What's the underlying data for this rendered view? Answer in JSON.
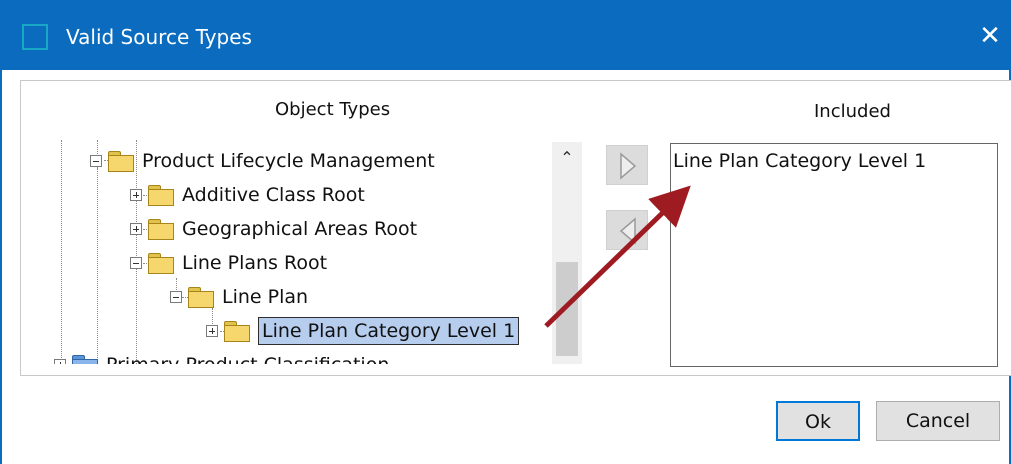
{
  "window": {
    "title": "Valid Source Types",
    "close_glyph": "✕"
  },
  "left_panel": {
    "header": "Object Types"
  },
  "right_panel": {
    "header": "Included"
  },
  "tree": {
    "nodes": [
      {
        "label": "Product Lifecycle Management",
        "expander": "minus",
        "icon": "folder-icon"
      },
      {
        "label": "Additive Class Root",
        "expander": "plus",
        "icon": "folder-icon"
      },
      {
        "label": "Geographical Areas Root",
        "expander": "plus",
        "icon": "folder-icon"
      },
      {
        "label": "Line Plans Root",
        "expander": "minus",
        "icon": "folder-icon"
      },
      {
        "label": "Line Plan",
        "expander": "minus",
        "icon": "folder-icon"
      },
      {
        "label": "Line Plan Category Level 1",
        "expander": "plus",
        "icon": "folder-icon",
        "selected": true
      },
      {
        "label": "Primary Product Classification",
        "expander": "plus",
        "icon": "folder-icon"
      }
    ]
  },
  "included": {
    "items": [
      "Line Plan Category Level 1"
    ]
  },
  "buttons": {
    "ok": "Ok",
    "cancel": "Cancel"
  },
  "colors": {
    "titlebar": "#0b6cbf",
    "selection": "#b6cdee",
    "arrow": "#9e1b22",
    "ok_border": "#0078d7"
  }
}
